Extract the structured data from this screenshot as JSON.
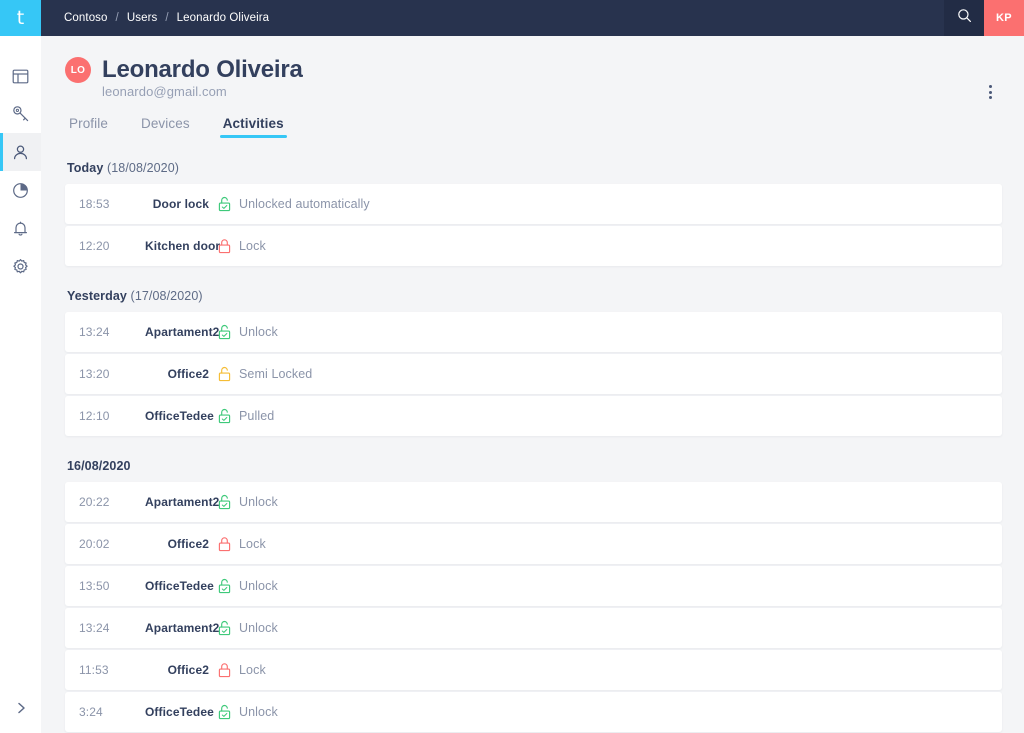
{
  "brand": {
    "logo_letter": "t",
    "logo_color": "#36c7f6",
    "accent_color": "#36c7f6",
    "topbar_color": "#28334e",
    "avatar_color": "#fb7070"
  },
  "sidebar": {
    "items": [
      {
        "icon": "dashboard-panel-icon",
        "name": "dashboard",
        "active": false
      },
      {
        "icon": "key-icon",
        "name": "keys",
        "active": false
      },
      {
        "icon": "person-icon",
        "name": "users",
        "active": true
      },
      {
        "icon": "pie-chart-icon",
        "name": "reports",
        "active": false
      },
      {
        "icon": "bell-icon",
        "name": "notifications",
        "active": false
      },
      {
        "icon": "gear-icon",
        "name": "settings",
        "active": false
      }
    ],
    "expand": {
      "icon": "chevron-right-icon",
      "label": ""
    }
  },
  "topbar": {
    "breadcrumb": [
      {
        "label": "Contoso"
      },
      {
        "label": "Users"
      },
      {
        "label": "Leonardo Oliveira"
      }
    ],
    "separator": "/",
    "search_icon": "search-icon",
    "user_avatar_initials": "KP"
  },
  "user": {
    "initials": "LO",
    "name": "Leonardo Oliveira",
    "email": "leonardo@gmail.com",
    "menu_icon": "kebab-menu-icon"
  },
  "tabs": [
    {
      "label": "Profile",
      "active": false
    },
    {
      "label": "Devices",
      "active": false
    },
    {
      "label": "Activities",
      "active": true
    }
  ],
  "activity_groups": [
    {
      "title_strong": "Today",
      "title_date": "(18/08/2020)",
      "rows": [
        {
          "time": "18:53",
          "device": "Door lock",
          "icon": "unlock-green-icon",
          "action": "Unlocked automatically"
        },
        {
          "time": "12:20",
          "device": "Kitchen door",
          "icon": "lock-red-icon",
          "action": "Lock"
        }
      ]
    },
    {
      "title_strong": "Yesterday",
      "title_date": "(17/08/2020)",
      "rows": [
        {
          "time": "13:24",
          "device": "Apartament2",
          "icon": "unlock-green-icon",
          "action": "Unlock"
        },
        {
          "time": "13:20",
          "device": "Office2",
          "icon": "semi-lock-yellow-icon",
          "action": "Semi Locked"
        },
        {
          "time": "12:10",
          "device": "OfficeTedee",
          "icon": "unlock-green-icon",
          "action": "Pulled"
        }
      ]
    },
    {
      "title_strong": "16/08/2020",
      "title_date": "",
      "rows": [
        {
          "time": "20:22",
          "device": "Apartament2",
          "icon": "unlock-green-icon",
          "action": "Unlock"
        },
        {
          "time": "20:02",
          "device": "Office2",
          "icon": "lock-red-icon",
          "action": "Lock"
        },
        {
          "time": "13:50",
          "device": "OfficeTedee",
          "icon": "unlock-green-icon",
          "action": "Unlock"
        },
        {
          "time": "13:24",
          "device": "Apartament2",
          "icon": "unlock-green-icon",
          "action": "Unlock"
        },
        {
          "time": "11:53",
          "device": "Office2",
          "icon": "lock-red-icon",
          "action": "Lock"
        },
        {
          "time": "3:24",
          "device": "OfficeTedee",
          "icon": "unlock-green-icon",
          "action": "Unlock"
        }
      ]
    }
  ],
  "icon_colors": {
    "unlock_green": "#3ec97a",
    "lock_red": "#fb7070",
    "semi_lock_yellow": "#f5bd35"
  }
}
